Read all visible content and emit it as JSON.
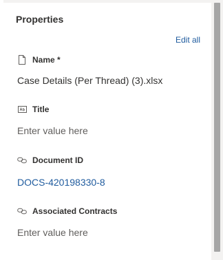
{
  "panel": {
    "title": "Properties",
    "edit_all_label": "Edit all"
  },
  "fields": [
    {
      "label": "Name *",
      "value": "Case Details (Per Thread) (3).xlsx",
      "icon": "document-icon",
      "value_kind": "text"
    },
    {
      "label": "Title",
      "value": "Enter value here",
      "icon": "text-field-icon",
      "value_kind": "placeholder"
    },
    {
      "label": "Document ID",
      "value": "DOCS-420198330-8",
      "icon": "link-icon",
      "value_kind": "link"
    },
    {
      "label": "Associated Contracts",
      "value": "Enter value here",
      "icon": "link-icon",
      "value_kind": "placeholder"
    }
  ],
  "colors": {
    "accent": "#1f5b9e",
    "text": "#323130",
    "placeholder": "#605e5c",
    "panel_bg": "#f3f2f1",
    "scroll_thumb": "#a6a6a6"
  }
}
